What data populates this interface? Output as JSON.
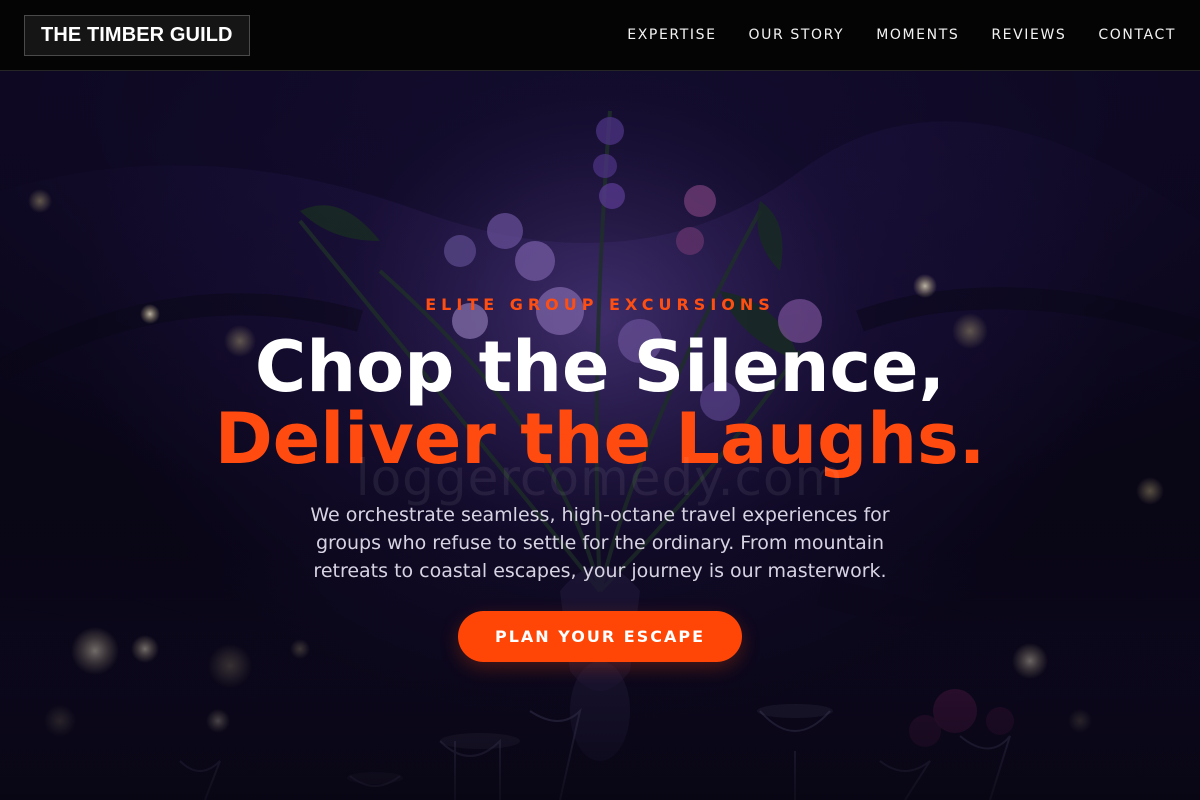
{
  "brand": {
    "name": "THE TIMBER GUILD"
  },
  "nav": {
    "items": [
      {
        "label": "EXPERTISE"
      },
      {
        "label": "OUR STORY"
      },
      {
        "label": "MOMENTS"
      },
      {
        "label": "REVIEWS"
      },
      {
        "label": "CONTACT"
      }
    ]
  },
  "hero": {
    "eyebrow": "ELITE GROUP EXCURSIONS",
    "headline_line1": "Chop the Silence,",
    "headline_line2": "Deliver the Laughs.",
    "watermark": "loggercomedy.com",
    "description": "We orchestrate seamless, high-octane travel experiences for groups who refuse to settle for the ordinary. From mountain retreats to coastal escapes, your journey is our masterwork.",
    "cta_label": "PLAN YOUR ESCAPE"
  },
  "colors": {
    "accent": "#ff4e12",
    "header_bg": "#040404",
    "hero_bg": "#17103a",
    "text_primary": "#ffffff"
  }
}
